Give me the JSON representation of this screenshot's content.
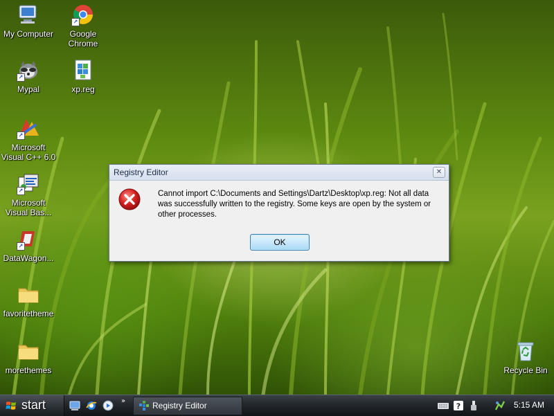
{
  "desktop": {
    "icons": [
      {
        "label": "My Computer",
        "icon": "my-computer-icon"
      },
      {
        "label": "Google Chrome",
        "icon": "chrome-icon"
      },
      {
        "label": "Mypal",
        "icon": "mypal-icon"
      },
      {
        "label": "xp.reg",
        "icon": "registry-file-icon"
      },
      {
        "label": "Microsoft Visual C++ 6.0",
        "icon": "visual-cpp-icon"
      },
      {
        "label": "Microsoft Visual Bas...",
        "icon": "visual-basic-icon"
      },
      {
        "label": "DataWagon...",
        "icon": "datawagon-icon"
      },
      {
        "label": "favoritetheme",
        "icon": "folder-icon"
      },
      {
        "label": "morethemes",
        "icon": "folder-icon"
      },
      {
        "label": "Recycle Bin",
        "icon": "recycle-bin-icon"
      }
    ]
  },
  "dialog": {
    "title": "Registry Editor",
    "close_symbol": "✕",
    "message": "Cannot import C:\\Documents and Settings\\Dartz\\Desktop\\xp.reg: Not all data was successfully written to the registry.  Some keys are open by the system or other processes.",
    "ok_label": "OK",
    "icon": "error-icon"
  },
  "taskbar": {
    "start_label": "start",
    "quick_launch": [
      "show-desktop-icon",
      "internet-explorer-icon",
      "media-player-icon"
    ],
    "more_symbol": "»",
    "tasks": [
      {
        "label": "Registry Editor",
        "icon": "registry-editor-icon"
      }
    ],
    "tray_icons": [
      "keyboard-icon",
      "help-icon",
      "usb-icon",
      "network-icon"
    ],
    "clock": "5:15 AM"
  },
  "colors": {
    "dialog_bg": "#f0f0f0",
    "taskbar": "#22272c",
    "error_red": "#d42020",
    "button_blue": "#c9e8fb"
  }
}
